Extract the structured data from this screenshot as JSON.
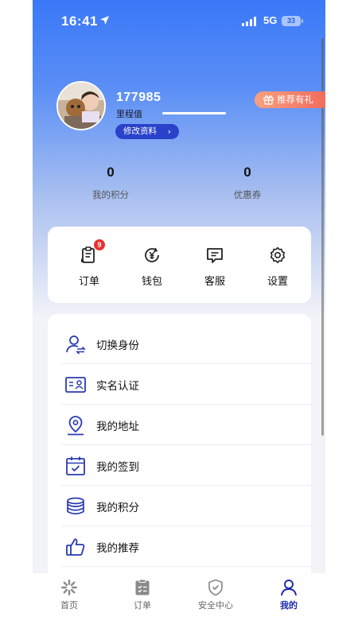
{
  "status_bar": {
    "time": "16:41",
    "network": "5G",
    "battery": "33"
  },
  "profile": {
    "user_id": "177985",
    "mileage_label": "里程值",
    "edit_label": "修改资料",
    "refer_label": "推荐有礼"
  },
  "stats": [
    {
      "value": "0",
      "label": "我的积分"
    },
    {
      "value": "0",
      "label": "优惠券"
    }
  ],
  "quick_actions": [
    {
      "label": "订单",
      "icon": "order-clipboard-icon",
      "badge": "9"
    },
    {
      "label": "钱包",
      "icon": "wallet-yuan-icon"
    },
    {
      "label": "客服",
      "icon": "chat-service-icon"
    },
    {
      "label": "设置",
      "icon": "settings-gear-icon"
    }
  ],
  "menu": [
    {
      "label": "切换身份",
      "icon": "switch-identity-icon"
    },
    {
      "label": "实名认证",
      "icon": "id-card-icon"
    },
    {
      "label": "我的地址",
      "icon": "location-pin-icon"
    },
    {
      "label": "我的签到",
      "icon": "calendar-check-icon"
    },
    {
      "label": "我的积分",
      "icon": "coin-stack-icon"
    },
    {
      "label": "我的推荐",
      "icon": "thumbs-up-icon"
    }
  ],
  "tabbar": [
    {
      "label": "首页",
      "icon": "home-pinwheel-icon"
    },
    {
      "label": "订单",
      "icon": "order-list-icon"
    },
    {
      "label": "安全中心",
      "icon": "shield-check-icon"
    },
    {
      "label": "我的",
      "icon": "person-icon",
      "active": true
    }
  ],
  "colors": {
    "accent": "#2a42c9",
    "hero_top": "#3a78f8",
    "badge": "#e8322f",
    "refer": "#f36a5b"
  }
}
